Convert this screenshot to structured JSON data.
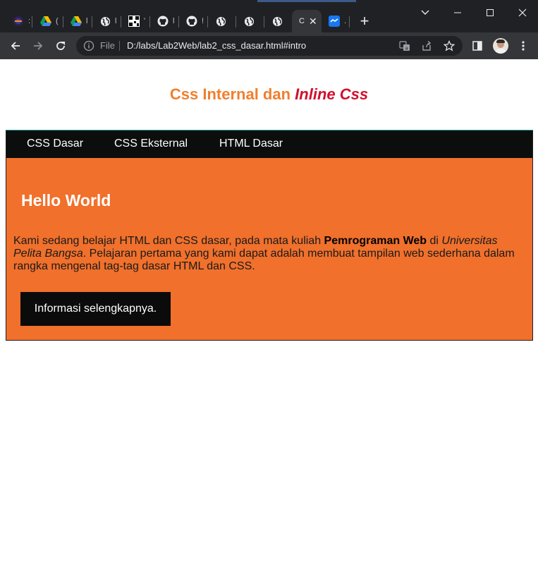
{
  "browser": {
    "tabs": [
      {
        "icon": "eclipse-icon",
        "stub": ":"
      },
      {
        "icon": "google-drive-icon",
        "stub": "("
      },
      {
        "icon": "google-drive-icon",
        "stub": "l"
      },
      {
        "icon": "globe-icon",
        "stub": "l"
      },
      {
        "icon": "qr-code-icon",
        "stub": "'"
      },
      {
        "icon": "github-icon",
        "stub": "l"
      },
      {
        "icon": "github-icon",
        "stub": "!"
      },
      {
        "icon": "globe-icon",
        "stub": ""
      },
      {
        "icon": "globe-icon",
        "stub": ""
      },
      {
        "icon": "globe-icon",
        "stub": ""
      },
      {
        "icon": "file-icon",
        "stub": "C",
        "active": true
      },
      {
        "icon": "chat-icon",
        "stub": "."
      }
    ],
    "omnibox": {
      "scheme_label": "File",
      "url": "D:/labs/Lab2Web/lab2_css_dasar.html#intro"
    }
  },
  "page": {
    "title_plain": "Css Internal dan ",
    "title_italic": "Inline Css",
    "nav": [
      "CSS Dasar",
      "CSS Eksternal",
      "HTML Dasar"
    ],
    "hero": {
      "heading": "Hello World",
      "paragraph_part1": "Kami sedang belajar HTML dan CSS dasar, pada mata kuliah ",
      "paragraph_bold": "Pemrograman Web",
      "paragraph_part2": " di ",
      "paragraph_italic": "Universitas Pelita Bangsa",
      "paragraph_part3": ". Pelajaran pertama yang kami dapat adalah membuat tampilan web sederhana dalam rangka mengenal tag-tag dasar HTML dan CSS.",
      "button_label": "Informasi selengkapnya."
    }
  },
  "colors": {
    "title_orange": "#f07f2e",
    "title_red": "#d0102d",
    "hero_orange": "#f0702c",
    "navbar_black": "#0c0d0d"
  }
}
